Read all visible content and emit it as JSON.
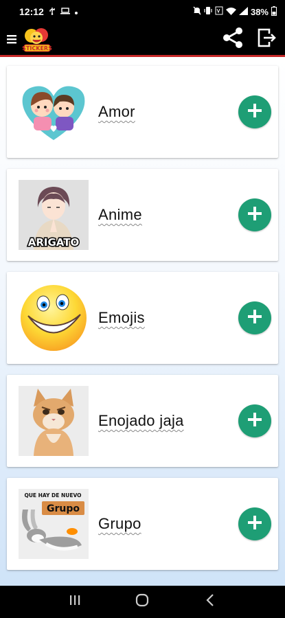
{
  "status_bar": {
    "time": "12:12",
    "battery_percent": "38%",
    "icons": [
      "usb-icon",
      "laptop-icon",
      "dot-icon",
      "mute-icon",
      "vibrate-icon",
      "volte-icon",
      "wifi-icon",
      "signal-icon",
      "battery-icon"
    ]
  },
  "toolbar": {
    "logo_text": "STICKERS",
    "icons": [
      "menu-icon",
      "share-icon",
      "exit-icon"
    ]
  },
  "packs": [
    {
      "label": "Amor",
      "thumb": "love-couple-heart"
    },
    {
      "label": "Anime",
      "thumb": "anime-boy-arigato",
      "thumb_caption": "ARIGATO"
    },
    {
      "label": "Emojis",
      "thumb": "smiley-emoji"
    },
    {
      "label": "Enojado jaja",
      "thumb": "angry-kitten"
    },
    {
      "label": "Grupo",
      "thumb": "bugs-bunny-grupo",
      "thumb_caption_top": "QUE HAY DE NUEVO",
      "thumb_caption_badge": "Grupo"
    }
  ],
  "colors": {
    "toolbar": "#000000",
    "accent_line": "#c62828",
    "add_button": "#1e9e75"
  },
  "nav_bar": {
    "icons": [
      "recents-icon",
      "home-icon",
      "back-icon"
    ]
  }
}
